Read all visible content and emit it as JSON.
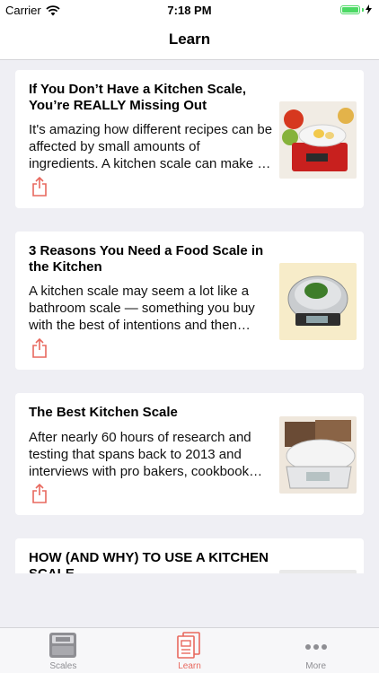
{
  "status_bar": {
    "carrier": "Carrier",
    "time": "7:18 PM",
    "icons": [
      "wifi-icon",
      "battery-icon",
      "charging-bolt-icon"
    ]
  },
  "nav": {
    "title": "Learn"
  },
  "articles": [
    {
      "title": "If You Don’t Have a Kitchen Scale, You’re REALLY Missing Out",
      "description": "It's amazing how different recipes can be affected by small amounts of ingredients. A kitchen scale can make a big difference.",
      "share_icon": "share-icon",
      "thumbnail": "kitchen-scale-with-eggs-and-fruit"
    },
    {
      "title": "3 Reasons You Need a Food Scale in the Kitchen",
      "description": "A kitchen scale may seem a lot like a bathroom scale — something you buy with the best of intentions and then never use.",
      "share_icon": "share-icon",
      "thumbnail": "steel-scale-with-herbs"
    },
    {
      "title": "The Best Kitchen Scale",
      "description": "After nearly 60 hours of research and testing that spans back to 2013 and interviews with pro bakers, cookbook authors and experts.",
      "share_icon": "share-icon",
      "thumbnail": "escali-scale-with-bread"
    },
    {
      "title": "HOW (AND WHY) TO USE A KITCHEN SCALE",
      "description": "",
      "share_icon": "share-icon",
      "thumbnail": "kitchen-scale-photo"
    }
  ],
  "tabs": [
    {
      "label": "Scales",
      "icon": "scale-icon",
      "active": false
    },
    {
      "label": "Learn",
      "icon": "learn-book-icon",
      "active": true
    },
    {
      "label": "More",
      "icon": "more-dots-icon",
      "active": false
    }
  ],
  "colors": {
    "accent": "#e8685e",
    "background": "#efeff4",
    "card": "#ffffff",
    "tab_inactive": "#8e8e93",
    "battery": "#4cd964"
  }
}
